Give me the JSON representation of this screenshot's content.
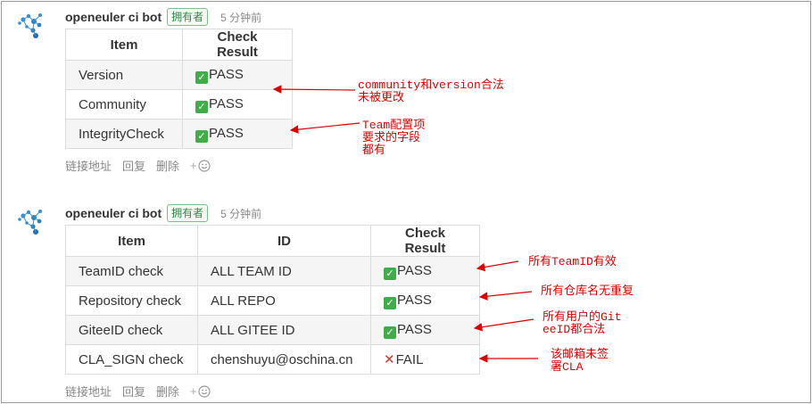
{
  "comments": [
    {
      "author": "openeuler ci bot",
      "badge": "拥有者",
      "time": "5 分钟前",
      "columns": [
        "Item",
        "Check Result"
      ],
      "rows": [
        {
          "item": "Version",
          "result": "PASS",
          "status": "pass"
        },
        {
          "item": "Community",
          "result": "PASS",
          "status": "pass"
        },
        {
          "item": "IntegrityCheck",
          "result": "PASS",
          "status": "pass"
        }
      ],
      "actions": {
        "link": "链接地址",
        "reply": "回复",
        "delete": "删除",
        "emoji_plus": "+"
      }
    },
    {
      "author": "openeuler ci bot",
      "badge": "拥有者",
      "time": "5 分钟前",
      "columns": [
        "Item",
        "ID",
        "Check Result"
      ],
      "rows": [
        {
          "item": "TeamID check",
          "id": "ALL TEAM ID",
          "result": "PASS",
          "status": "pass"
        },
        {
          "item": "Repository check",
          "id": "ALL REPO",
          "result": "PASS",
          "status": "pass"
        },
        {
          "item": "GiteeID check",
          "id": "ALL GITEE ID",
          "result": "PASS",
          "status": "pass"
        },
        {
          "item": "CLA_SIGN check",
          "id": "chenshuyu@oschina.cn",
          "result": "FAIL",
          "status": "fail"
        }
      ],
      "actions": {
        "link": "链接地址",
        "reply": "回复",
        "delete": "删除",
        "emoji_plus": "+"
      }
    }
  ],
  "annotations": [
    "community和version合法\n未被更改",
    "Team配置项\n要求的字段\n都有",
    "所有TeamID有效",
    "所有仓库名无重复",
    "所有用户的Git\neeID都合法",
    "该邮箱未签\n署CLA"
  ],
  "colors": {
    "annotation": "#e00000",
    "pass": "#3fae49",
    "fail": "#d9342b",
    "badge": "#2e8b47"
  },
  "icons": {
    "avatar": "openeuler-logo-icon",
    "pass": "check-mark-icon",
    "fail": "cross-mark-icon",
    "emoji": "smiley-icon"
  }
}
